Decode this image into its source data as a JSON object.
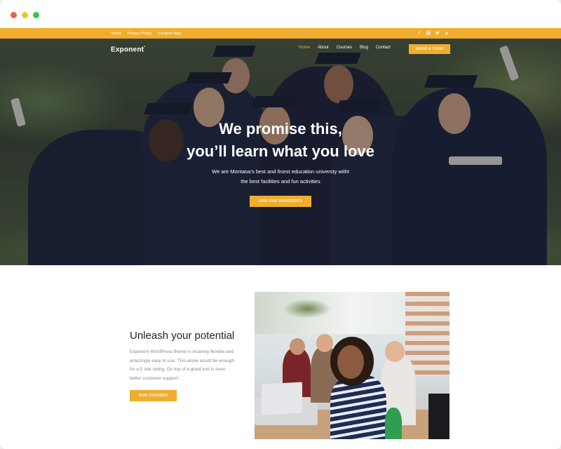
{
  "topbar": {
    "links": [
      "Terms",
      "Privacy Policy",
      "Campus Map"
    ],
    "social_icons": [
      "facebook-icon",
      "instagram-icon",
      "twitter-icon",
      "pinterest-icon"
    ]
  },
  "nav": {
    "logo": "Exponent",
    "logo_mark": "°",
    "menu": [
      "Home",
      "About",
      "Courses",
      "Blog",
      "Contact"
    ],
    "active": "Home",
    "cta": "BOOK A TOUR"
  },
  "hero": {
    "title_line1": "We promise this,",
    "title_line2": "you’ll learn what you love",
    "subtitle_line1": "We are Montana’s best and finest education universty witht",
    "subtitle_line2": "the best facilities and fun activities",
    "cta": "JOIN OUR UNIVERSITY"
  },
  "section": {
    "title": "Unleash your potential",
    "body": "Exponent WordPress theme is insanely flexible and amazingly easy to use. This alone would be enough for a 5 star rating. On top of a great tool is even better customer support.",
    "cta": "OUR COURSES"
  },
  "colors": {
    "accent": "#f0ad2e",
    "dark": "#222222",
    "muted": "#888888"
  }
}
